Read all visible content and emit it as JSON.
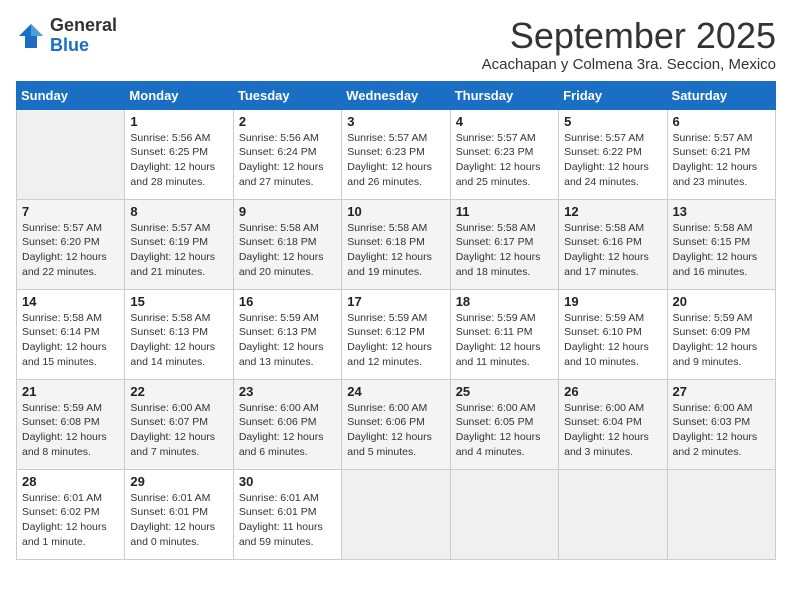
{
  "header": {
    "logo_general": "General",
    "logo_blue": "Blue",
    "month_title": "September 2025",
    "location": "Acachapan y Colmena 3ra. Seccion, Mexico"
  },
  "weekdays": [
    "Sunday",
    "Monday",
    "Tuesday",
    "Wednesday",
    "Thursday",
    "Friday",
    "Saturday"
  ],
  "weeks": [
    [
      {
        "day": "",
        "info": ""
      },
      {
        "day": "1",
        "info": "Sunrise: 5:56 AM\nSunset: 6:25 PM\nDaylight: 12 hours\nand 28 minutes."
      },
      {
        "day": "2",
        "info": "Sunrise: 5:56 AM\nSunset: 6:24 PM\nDaylight: 12 hours\nand 27 minutes."
      },
      {
        "day": "3",
        "info": "Sunrise: 5:57 AM\nSunset: 6:23 PM\nDaylight: 12 hours\nand 26 minutes."
      },
      {
        "day": "4",
        "info": "Sunrise: 5:57 AM\nSunset: 6:23 PM\nDaylight: 12 hours\nand 25 minutes."
      },
      {
        "day": "5",
        "info": "Sunrise: 5:57 AM\nSunset: 6:22 PM\nDaylight: 12 hours\nand 24 minutes."
      },
      {
        "day": "6",
        "info": "Sunrise: 5:57 AM\nSunset: 6:21 PM\nDaylight: 12 hours\nand 23 minutes."
      }
    ],
    [
      {
        "day": "7",
        "info": "Sunrise: 5:57 AM\nSunset: 6:20 PM\nDaylight: 12 hours\nand 22 minutes."
      },
      {
        "day": "8",
        "info": "Sunrise: 5:57 AM\nSunset: 6:19 PM\nDaylight: 12 hours\nand 21 minutes."
      },
      {
        "day": "9",
        "info": "Sunrise: 5:58 AM\nSunset: 6:18 PM\nDaylight: 12 hours\nand 20 minutes."
      },
      {
        "day": "10",
        "info": "Sunrise: 5:58 AM\nSunset: 6:18 PM\nDaylight: 12 hours\nand 19 minutes."
      },
      {
        "day": "11",
        "info": "Sunrise: 5:58 AM\nSunset: 6:17 PM\nDaylight: 12 hours\nand 18 minutes."
      },
      {
        "day": "12",
        "info": "Sunrise: 5:58 AM\nSunset: 6:16 PM\nDaylight: 12 hours\nand 17 minutes."
      },
      {
        "day": "13",
        "info": "Sunrise: 5:58 AM\nSunset: 6:15 PM\nDaylight: 12 hours\nand 16 minutes."
      }
    ],
    [
      {
        "day": "14",
        "info": "Sunrise: 5:58 AM\nSunset: 6:14 PM\nDaylight: 12 hours\nand 15 minutes."
      },
      {
        "day": "15",
        "info": "Sunrise: 5:58 AM\nSunset: 6:13 PM\nDaylight: 12 hours\nand 14 minutes."
      },
      {
        "day": "16",
        "info": "Sunrise: 5:59 AM\nSunset: 6:13 PM\nDaylight: 12 hours\nand 13 minutes."
      },
      {
        "day": "17",
        "info": "Sunrise: 5:59 AM\nSunset: 6:12 PM\nDaylight: 12 hours\nand 12 minutes."
      },
      {
        "day": "18",
        "info": "Sunrise: 5:59 AM\nSunset: 6:11 PM\nDaylight: 12 hours\nand 11 minutes."
      },
      {
        "day": "19",
        "info": "Sunrise: 5:59 AM\nSunset: 6:10 PM\nDaylight: 12 hours\nand 10 minutes."
      },
      {
        "day": "20",
        "info": "Sunrise: 5:59 AM\nSunset: 6:09 PM\nDaylight: 12 hours\nand 9 minutes."
      }
    ],
    [
      {
        "day": "21",
        "info": "Sunrise: 5:59 AM\nSunset: 6:08 PM\nDaylight: 12 hours\nand 8 minutes."
      },
      {
        "day": "22",
        "info": "Sunrise: 6:00 AM\nSunset: 6:07 PM\nDaylight: 12 hours\nand 7 minutes."
      },
      {
        "day": "23",
        "info": "Sunrise: 6:00 AM\nSunset: 6:06 PM\nDaylight: 12 hours\nand 6 minutes."
      },
      {
        "day": "24",
        "info": "Sunrise: 6:00 AM\nSunset: 6:06 PM\nDaylight: 12 hours\nand 5 minutes."
      },
      {
        "day": "25",
        "info": "Sunrise: 6:00 AM\nSunset: 6:05 PM\nDaylight: 12 hours\nand 4 minutes."
      },
      {
        "day": "26",
        "info": "Sunrise: 6:00 AM\nSunset: 6:04 PM\nDaylight: 12 hours\nand 3 minutes."
      },
      {
        "day": "27",
        "info": "Sunrise: 6:00 AM\nSunset: 6:03 PM\nDaylight: 12 hours\nand 2 minutes."
      }
    ],
    [
      {
        "day": "28",
        "info": "Sunrise: 6:01 AM\nSunset: 6:02 PM\nDaylight: 12 hours\nand 1 minute."
      },
      {
        "day": "29",
        "info": "Sunrise: 6:01 AM\nSunset: 6:01 PM\nDaylight: 12 hours\nand 0 minutes."
      },
      {
        "day": "30",
        "info": "Sunrise: 6:01 AM\nSunset: 6:01 PM\nDaylight: 11 hours\nand 59 minutes."
      },
      {
        "day": "",
        "info": ""
      },
      {
        "day": "",
        "info": ""
      },
      {
        "day": "",
        "info": ""
      },
      {
        "day": "",
        "info": ""
      }
    ]
  ]
}
